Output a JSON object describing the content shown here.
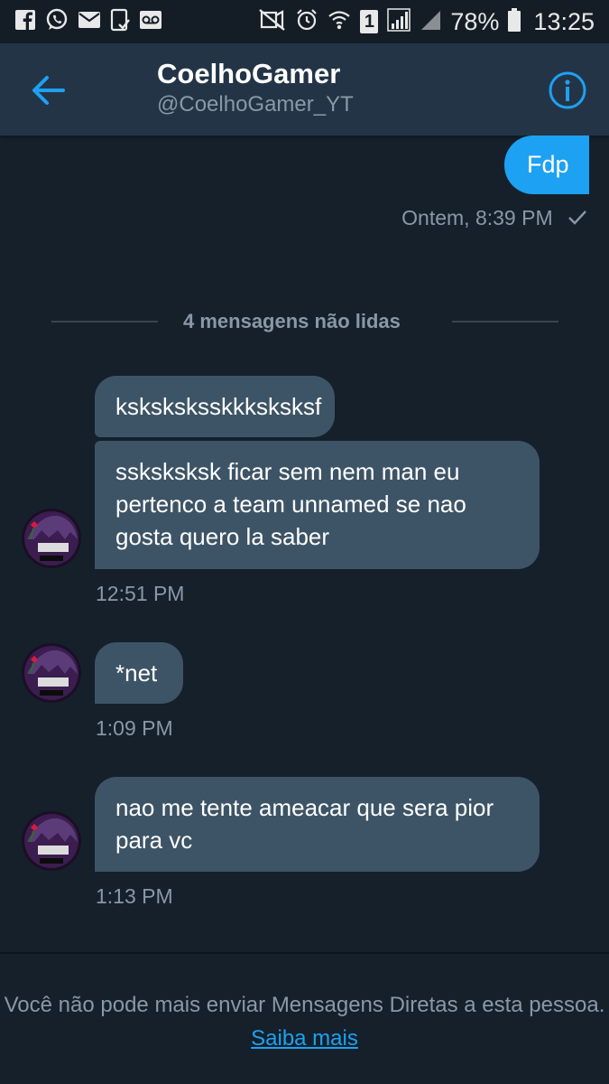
{
  "status_bar": {
    "battery": "78%",
    "sim": "1",
    "time": "13:25"
  },
  "header": {
    "title": "CoelhoGamer",
    "handle": "@CoelhoGamer_YT"
  },
  "sent": {
    "text": "Fdp",
    "timestamp": "Ontem, 8:39 PM"
  },
  "unread_divider": "4 mensagens não lidas",
  "received": [
    {
      "text": "ksksksksskkksksksf"
    },
    {
      "text": "ssksksksk ficar sem nem man eu pertenco a team unnamed se nao gosta quero la saber"
    },
    {
      "time": "12:51 PM"
    },
    {
      "text": "*net",
      "time": "1:09 PM"
    },
    {
      "text": "nao me tente ameacar que sera pior para vc",
      "time": "1:13 PM"
    }
  ],
  "footer": {
    "text": "Você não pode mais enviar Mensagens Diretas a esta pessoa.",
    "link": "Saiba mais"
  },
  "colors": {
    "background": "#15202b",
    "header": "#243447",
    "sent_bubble": "#1da1f2",
    "received_bubble": "#3d5466",
    "muted_text": "#8899a6",
    "link": "#1da1f2"
  }
}
